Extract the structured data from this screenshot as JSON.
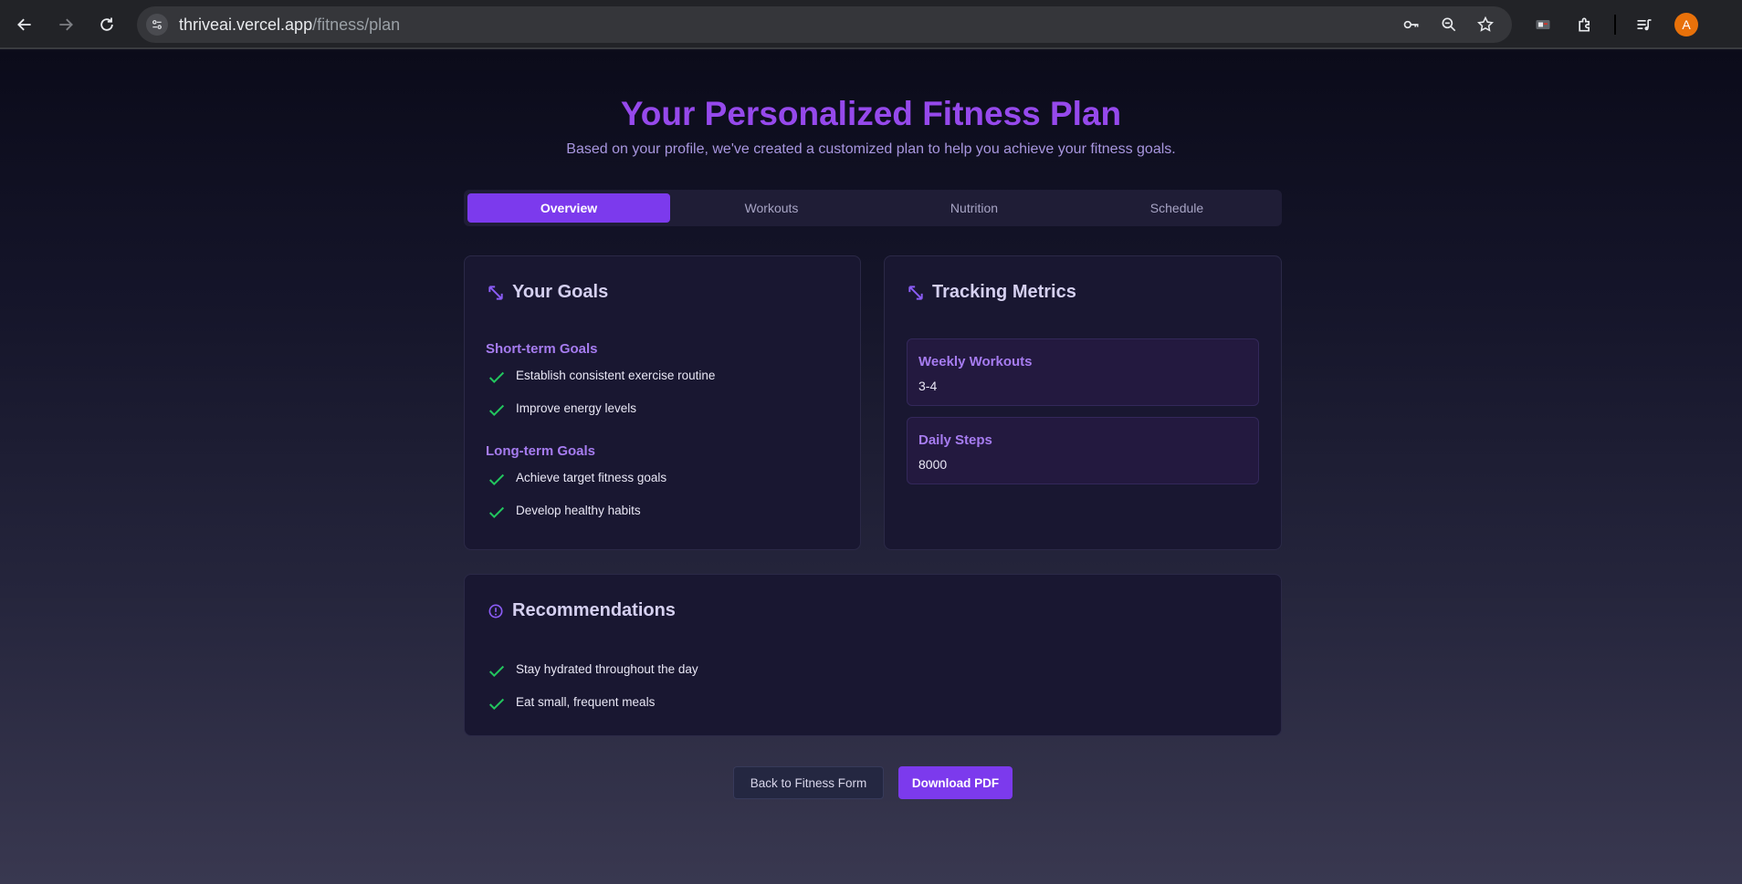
{
  "browser": {
    "url_host": "thriveai.vercel.app",
    "url_path": "/fitness/plan",
    "profile_initial": "A"
  },
  "header": {
    "title": "Your Personalized Fitness Plan",
    "subtitle": "Based on your profile, we've created a customized plan to help you achieve your fitness goals."
  },
  "tabs": [
    {
      "label": "Overview",
      "active": true
    },
    {
      "label": "Workouts",
      "active": false
    },
    {
      "label": "Nutrition",
      "active": false
    },
    {
      "label": "Schedule",
      "active": false
    }
  ],
  "goals": {
    "title": "Your Goals",
    "short_term": {
      "heading": "Short-term Goals",
      "items": [
        "Establish consistent exercise routine",
        "Improve energy levels"
      ]
    },
    "long_term": {
      "heading": "Long-term Goals",
      "items": [
        "Achieve target fitness goals",
        "Develop healthy habits"
      ]
    }
  },
  "metrics": {
    "title": "Tracking Metrics",
    "items": [
      {
        "label": "Weekly Workouts",
        "value": "3-4"
      },
      {
        "label": "Daily Steps",
        "value": "8000"
      }
    ]
  },
  "recommendations": {
    "title": "Recommendations",
    "items": [
      "Stay hydrated throughout the day",
      "Eat small, frequent meals"
    ]
  },
  "actions": {
    "back_label": "Back to Fitness Form",
    "download_label": "Download PDF"
  },
  "colors": {
    "accent": "#7c3aed",
    "title": "#9649ec",
    "check": "#22c55e"
  }
}
